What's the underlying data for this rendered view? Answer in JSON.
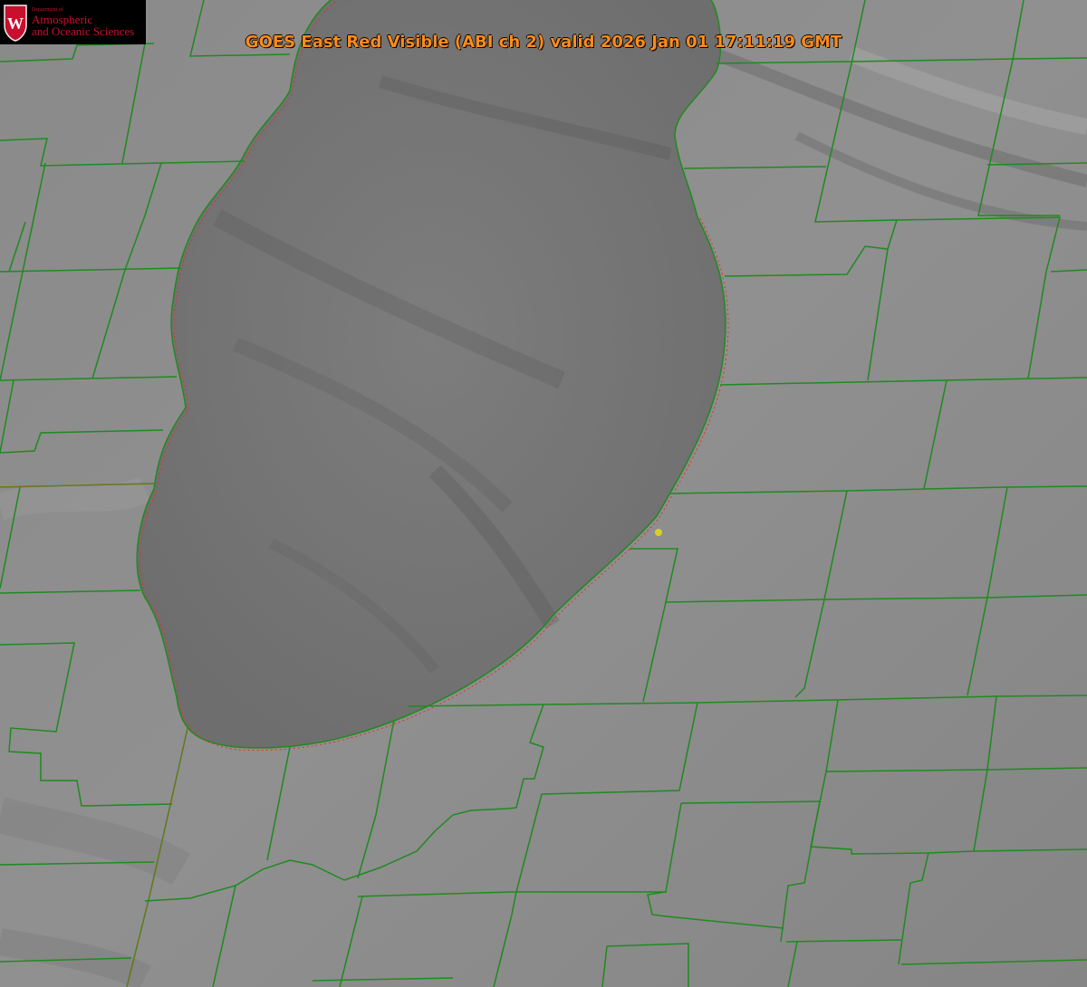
{
  "title": "GOES East Red Visible (ABI ch 2) valid 2026 Jan 01 17:11:19 GMT",
  "logo": {
    "department": "Department of",
    "line1": "Atmospheric",
    "line2": "and Oceanic Sciences",
    "crest_letter": "W"
  },
  "colors": {
    "county_lines": "#1f8a1f",
    "shoreline_dotted": "#e03030",
    "title_text": "#ff8c1a",
    "marker": "#d8d020"
  },
  "icons": {
    "crest": "uw-crest-icon",
    "marker": "location-dot-icon"
  }
}
